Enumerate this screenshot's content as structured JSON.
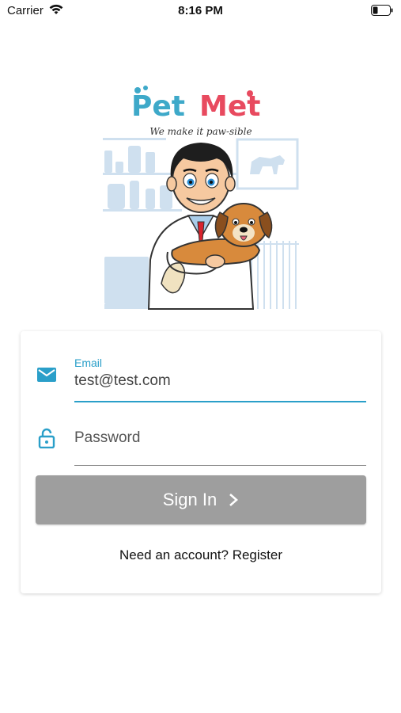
{
  "status_bar": {
    "carrier": "Carrier",
    "time": "8:16 PM",
    "wifi_icon": "wifi-icon",
    "battery_icon": "battery-low-icon"
  },
  "brand": {
    "name_part1": "Pet",
    "name_part2": "Met",
    "tagline": "We make it paw-sible",
    "colors": {
      "part1": "#3ea9c9",
      "part2": "#e84a5f"
    }
  },
  "login": {
    "email": {
      "label": "Email",
      "value": "test@test.com",
      "icon": "mail-icon"
    },
    "password": {
      "placeholder": "Password",
      "icon": "lock-open-icon"
    },
    "signin_label": "Sign In",
    "register_prefix": "Need an account?",
    "register_link": "Register"
  },
  "colors": {
    "accent": "#2a9fc9",
    "button_disabled": "#9e9e9e"
  }
}
